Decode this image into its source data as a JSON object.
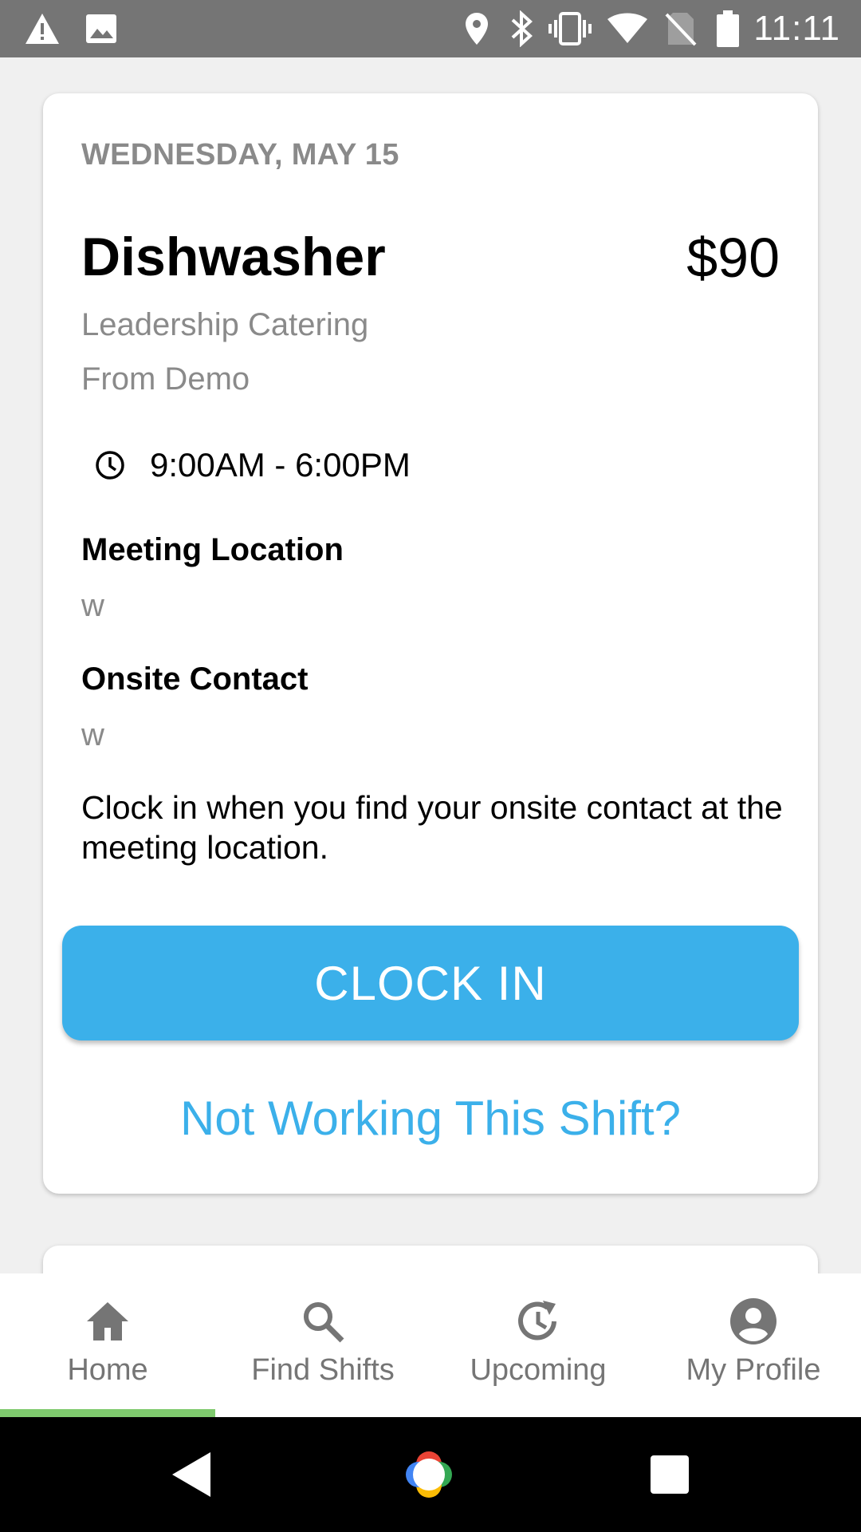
{
  "status_bar": {
    "time": "11:11",
    "icons": [
      "warning-icon",
      "image-icon",
      "location-icon",
      "bluetooth-icon",
      "vibrate-icon",
      "wifi-icon",
      "no-sim-icon",
      "battery-icon"
    ]
  },
  "shift": {
    "date": "WEDNESDAY, MAY 15",
    "title": "Dishwasher",
    "pay": "$90",
    "company": "Leadership Catering",
    "source": "From Demo",
    "time_range": "9:00AM - 6:00PM",
    "meeting_location_label": "Meeting Location",
    "meeting_location_value": "w",
    "onsite_contact_label": "Onsite Contact",
    "onsite_contact_value": "w",
    "instructions": "Clock in when you find your onsite contact at the meeting location.",
    "clock_in_label": "CLOCK IN",
    "not_working_label": "Not Working This Shift?"
  },
  "bottom_nav": {
    "items": [
      {
        "label": "Home",
        "icon": "home-icon",
        "active": true
      },
      {
        "label": "Find Shifts",
        "icon": "search-icon",
        "active": false
      },
      {
        "label": "Upcoming",
        "icon": "history-icon",
        "active": false
      },
      {
        "label": "My Profile",
        "icon": "account-icon",
        "active": false
      }
    ]
  },
  "colors": {
    "accent": "#3bb0ea",
    "active_indicator": "#7fca6e",
    "muted_text": "#8a8a8a",
    "status_bar": "#757575"
  }
}
